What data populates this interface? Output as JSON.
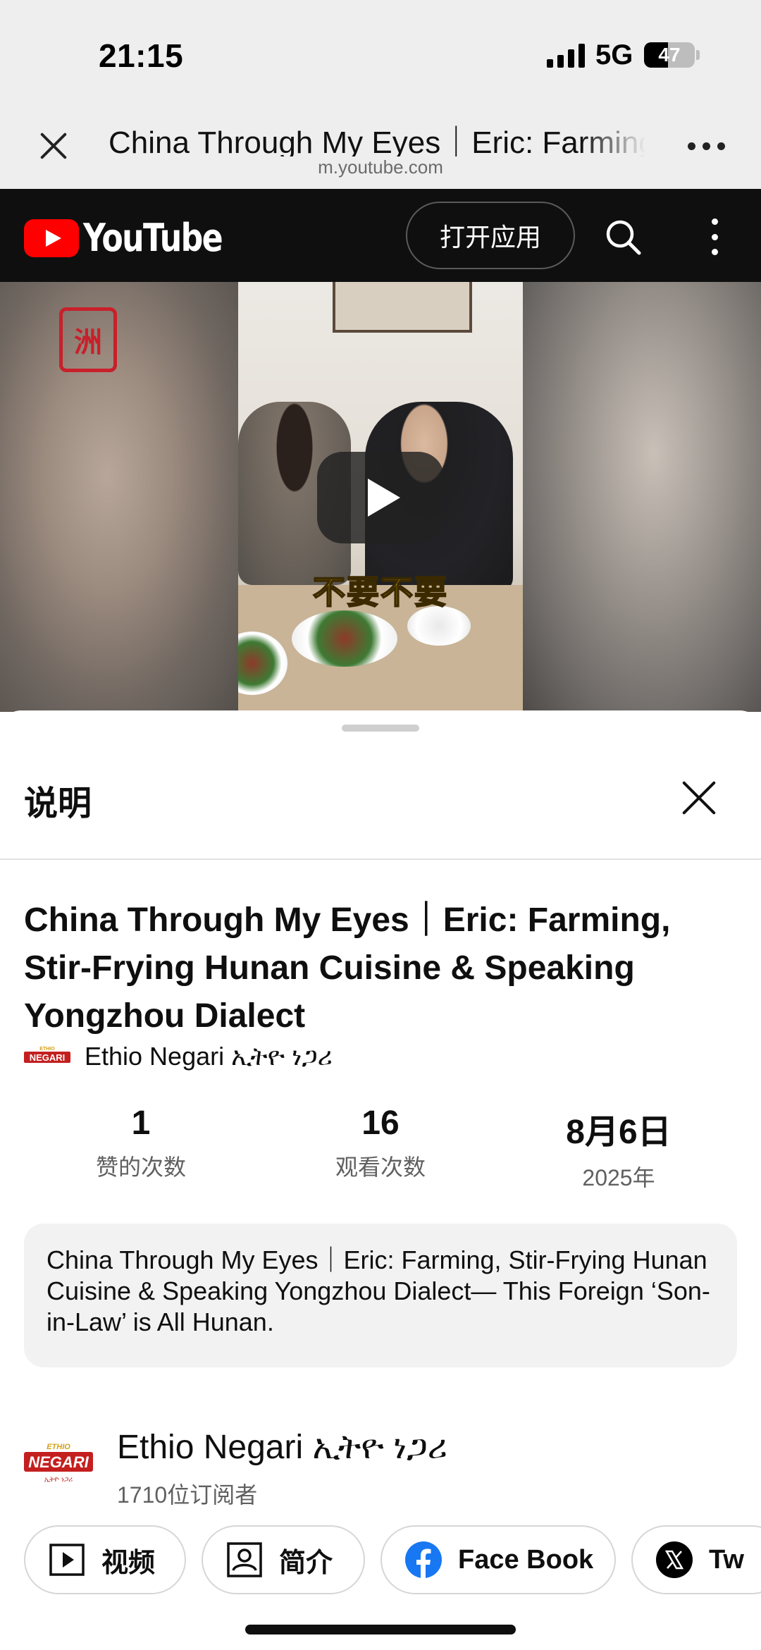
{
  "status_bar": {
    "time": "21:15",
    "network": "5G",
    "battery_level": "47",
    "battery_fraction": 0.47
  },
  "browser": {
    "title": "China Through My Eyes｜Eric: Farming, Stir-Frying Hunan Cuisine & Speaking Yongzhou Dialect",
    "url": "m.youtube.com"
  },
  "youtube_bar": {
    "logo_text": "YouTube",
    "open_app_label": "打开应用",
    "brand_color": "#ff0000"
  },
  "video": {
    "subtitle": "不要不要",
    "watermark_text": "洲"
  },
  "sheet": {
    "title": "说明",
    "video_title": "China Through My Eyes｜Eric: Farming, Stir-Frying Hunan Cuisine & Speaking Yongzhou Dialect",
    "channel_name": "Ethio Negari ኢትዮ ነጋሪ",
    "stats": [
      {
        "value": "1",
        "label": "赞的次数"
      },
      {
        "value": "16",
        "label": "观看次数"
      },
      {
        "value": "8月6日",
        "label": "2025年"
      }
    ],
    "description": "China Through My Eyes｜Eric: Farming, Stir-Frying Hunan Cuisine & Speaking Yongzhou Dialect— This Foreign ‘Son-in-Law’ is All Hunan.",
    "channel": {
      "name": "Ethio Negari ኢትዮ ነጋሪ",
      "subscribers": "1710位订阅者",
      "logo_top": "ETHIO",
      "logo_main": "NEGARI",
      "logo_bottom": "ኢትዮ ነጋሪ"
    },
    "chips": [
      {
        "label": "视频",
        "icon": "video-play-icon"
      },
      {
        "label": "简介",
        "icon": "profile-icon"
      },
      {
        "label": "Face Book",
        "icon": "facebook-icon"
      },
      {
        "label": "Tw",
        "icon": "x-twitter-icon"
      }
    ]
  }
}
